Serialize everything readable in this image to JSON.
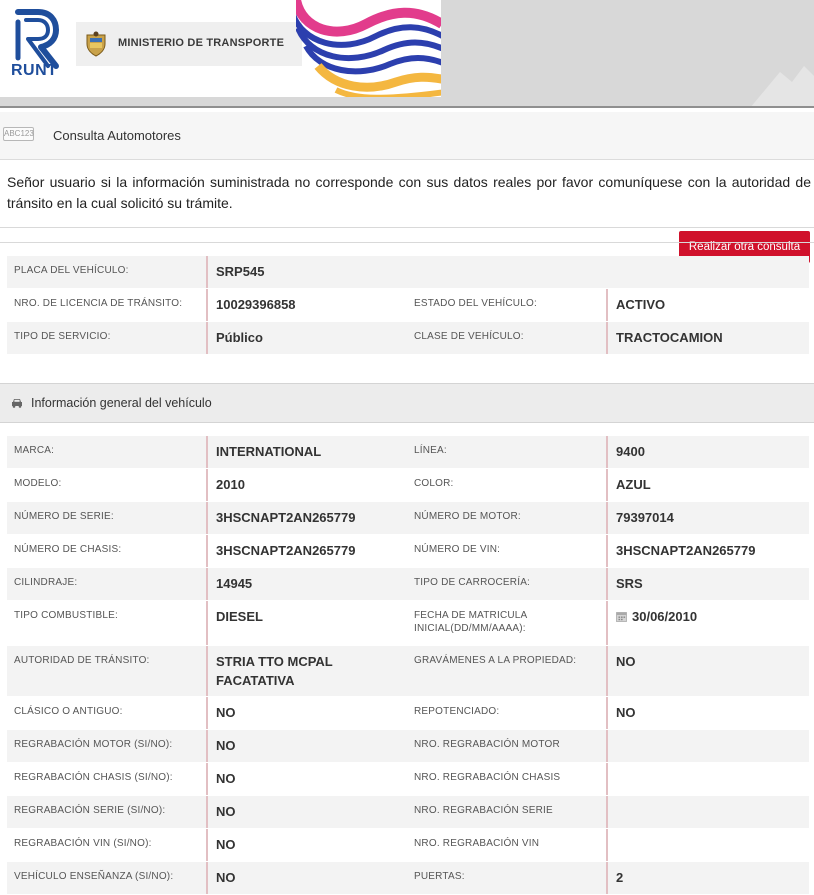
{
  "branding": {
    "runt_label": "RUNT",
    "ministry_label": "MINISTERIO DE TRANSPORTE"
  },
  "tab": {
    "icon_text": "ABC123",
    "title": "Consulta Automotores",
    "new_query_label": "Realizar otra consulta"
  },
  "notice": "Señor usuario si la información suministrada no corresponde con sus datos reales por favor comuníquese con la autoridad de tránsito en la cual solicitó su trámite.",
  "summary": {
    "placa_label": "PLACA DEL VEHÍCULO:",
    "placa_value": "SRP545",
    "licencia_label": "NRO. DE LICENCIA DE TRÁNSITO:",
    "licencia_value": "10029396858",
    "estado_label": "ESTADO DEL VEHÍCULO:",
    "estado_value": "ACTIVO",
    "servicio_label": "TIPO DE SERVICIO:",
    "servicio_value": "Público",
    "clase_label": "CLASE DE VEHÍCULO:",
    "clase_value": "TRACTOCAMION"
  },
  "section": {
    "title": "Información general del vehículo"
  },
  "details": [
    {
      "l1": "MARCA:",
      "v1": "INTERNATIONAL",
      "l2": "LÍNEA:",
      "v2": "9400"
    },
    {
      "l1": "MODELO:",
      "v1": "2010",
      "l2": "COLOR:",
      "v2": "AZUL"
    },
    {
      "l1": "NÚMERO DE SERIE:",
      "v1": "3HSCNAPT2AN265779",
      "l2": "NÚMERO DE MOTOR:",
      "v2": "79397014"
    },
    {
      "l1": "NÚMERO DE CHASIS:",
      "v1": "3HSCNAPT2AN265779",
      "l2": "NÚMERO DE VIN:",
      "v2": "3HSCNAPT2AN265779"
    },
    {
      "l1": "CILINDRAJE:",
      "v1": "14945",
      "l2": "TIPO DE CARROCERÍA:",
      "v2": "SRS"
    },
    {
      "l1": "TIPO COMBUSTIBLE:",
      "v1": "DIESEL",
      "l2": "FECHA DE MATRICULA INICIAL(DD/MM/AAAA):",
      "v2": "30/06/2010"
    },
    {
      "l1": "AUTORIDAD DE TRÁNSITO:",
      "v1": "STRIA TTO MCPAL FACATATIVA",
      "l2": "GRAVÁMENES A LA PROPIEDAD:",
      "v2": "NO"
    },
    {
      "l1": "CLÁSICO O ANTIGUO:",
      "v1": "NO",
      "l2": "REPOTENCIADO:",
      "v2": "NO"
    },
    {
      "l1": "REGRABACIÓN MOTOR (SI/NO):",
      "v1": "NO",
      "l2": "NRO. REGRABACIÓN MOTOR",
      "v2": ""
    },
    {
      "l1": "REGRABACIÓN CHASIS (SI/NO):",
      "v1": "NO",
      "l2": "NRO. REGRABACIÓN CHASIS",
      "v2": ""
    },
    {
      "l1": "REGRABACIÓN SERIE (SI/NO):",
      "v1": "NO",
      "l2": "NRO. REGRABACIÓN SERIE",
      "v2": ""
    },
    {
      "l1": "REGRABACIÓN VIN (SI/NO):",
      "v1": "NO",
      "l2": "NRO. REGRABACIÓN VIN",
      "v2": ""
    },
    {
      "l1": "VEHÍCULO ENSEÑANZA (SI/NO):",
      "v1": "NO",
      "l2": "PUERTAS:",
      "v2": "2"
    }
  ],
  "colors": {
    "accent_red": "#d0112b",
    "runt_blue": "#1f4e9c",
    "value_border": "#e2bfc3"
  }
}
